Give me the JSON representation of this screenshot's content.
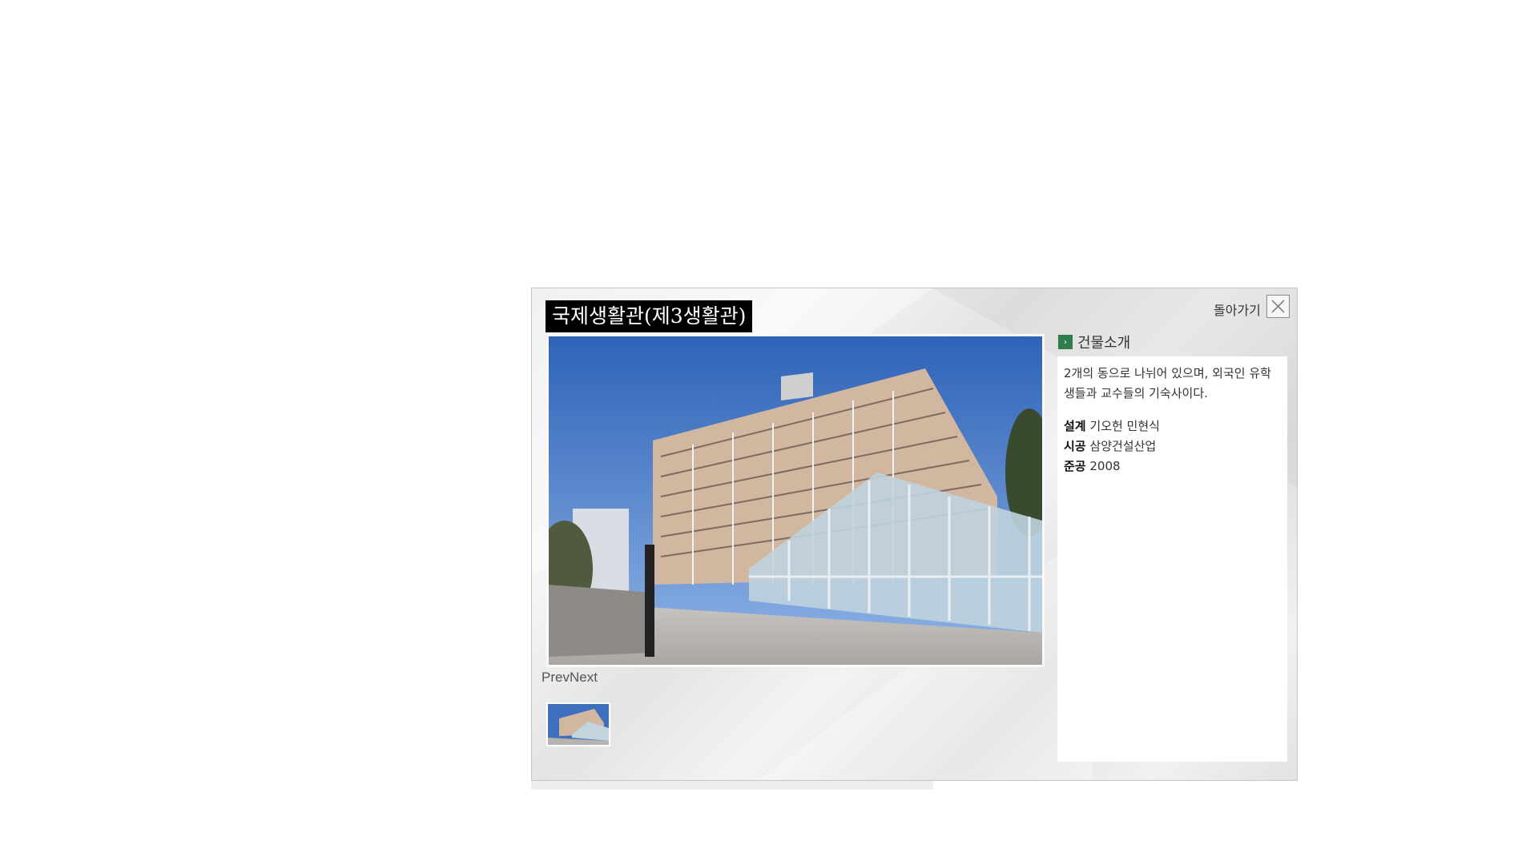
{
  "popup": {
    "title": "국제생활관(제3생활관)",
    "back_label": "돌아가기",
    "close_icon": "close-icon",
    "nav": {
      "prev_label": "Prev",
      "next_label": "Next"
    },
    "section": {
      "icon": "arrow-right-icon",
      "title": "건물소개"
    },
    "info": {
      "description": "2개의 동으로 나뉘어 있으며, 외국인 유학생들과 교수들의 기숙사이다.",
      "rows": [
        {
          "label": "설계",
          "value": "기오헌 민현식"
        },
        {
          "label": "시공",
          "value": "삼양건설산업"
        },
        {
          "label": "준공",
          "value": "2008"
        }
      ]
    },
    "colors": {
      "title_bg": "#000000",
      "section_icon": "#2f7d4c",
      "sky": "#3c6fc0"
    }
  }
}
